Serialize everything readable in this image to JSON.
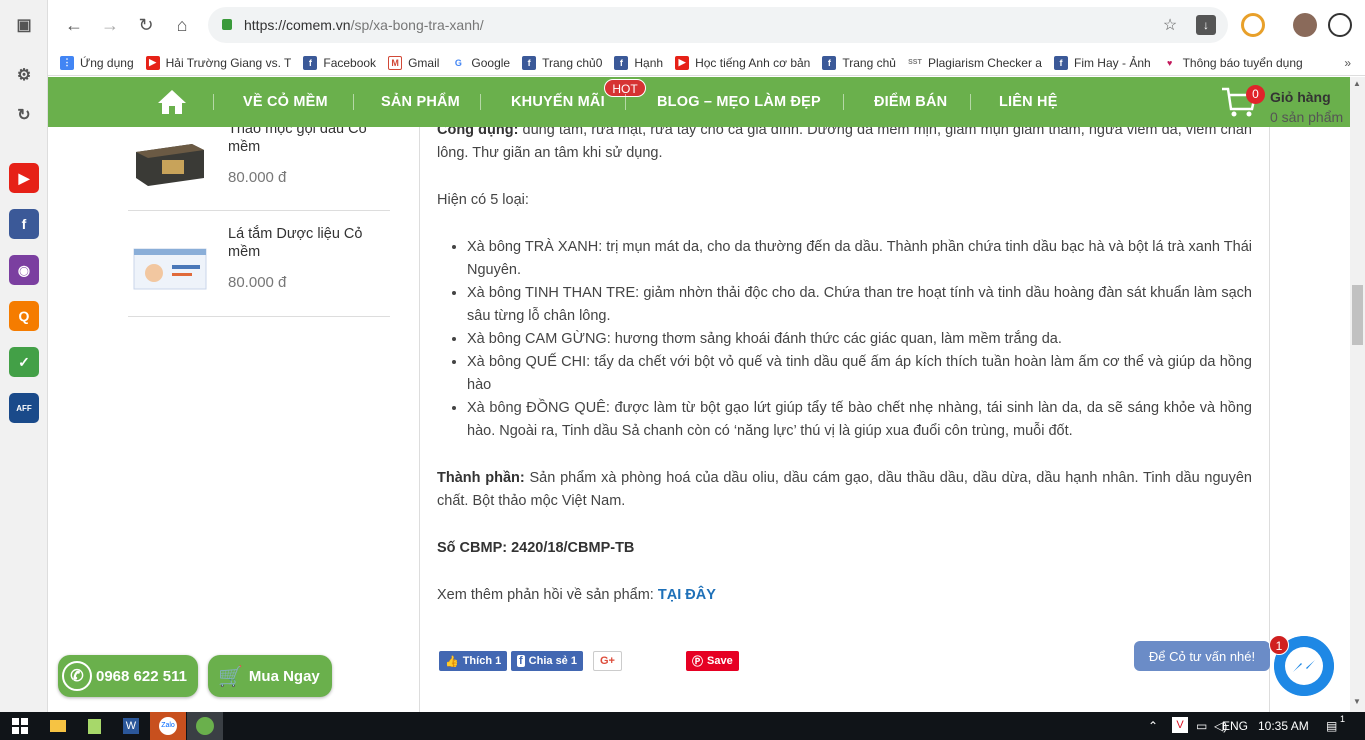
{
  "browser": {
    "url_host": "https://comem.vn",
    "url_path": "/sp/xa-bong-tra-xanh/",
    "bookmarks": [
      {
        "label": "Ứng dụng",
        "icon": "apps-grid-icon",
        "color": "#4285f4"
      },
      {
        "label": "Hải Trường Giang vs. T",
        "icon": "youtube-icon",
        "color": "#e62117"
      },
      {
        "label": "Facebook",
        "icon": "facebook-icon",
        "color": "#3b5998"
      },
      {
        "label": "Gmail",
        "icon": "gmail-icon",
        "color": "#d14836"
      },
      {
        "label": "Google",
        "icon": "google-icon",
        "color": "#4285f4"
      },
      {
        "label": "Trang chủ0",
        "icon": "facebook-icon",
        "color": "#3b5998"
      },
      {
        "label": "Hạnh",
        "icon": "facebook-icon",
        "color": "#3b5998"
      },
      {
        "label": "Học tiếng Anh cơ bản",
        "icon": "youtube-icon",
        "color": "#e62117"
      },
      {
        "label": "Trang chủ",
        "icon": "facebook-icon",
        "color": "#3b5998"
      },
      {
        "label": "Plagiarism Checker a",
        "icon": "sst-icon",
        "color": "#777777"
      },
      {
        "label": "Fim Hay - Ảnh",
        "icon": "facebook-icon",
        "color": "#3b5998"
      },
      {
        "label": "Thông báo tuyển dụng",
        "icon": "heart-icon",
        "color": "#c2185b"
      }
    ]
  },
  "nav": {
    "items": [
      "VỀ CỎ MỀM",
      "SẢN PHẨM",
      "KHUYẾN MÃI",
      "BLOG – MẸO LÀM ĐẸP",
      "ĐIỂM BÁN",
      "LIÊN HỆ"
    ],
    "hot_badge": "HOT",
    "cart_badge": "0",
    "cart_title": "Giỏ hàng",
    "cart_count": "0 sản phẩm"
  },
  "sidebar_products": [
    {
      "name": "Thảo mộc gội đầu Cỏ mềm",
      "price": "80.000 đ"
    },
    {
      "name": "Lá tắm Dược liệu Cỏ mềm",
      "price": "80.000 đ"
    }
  ],
  "article": {
    "uses_label": "Công dụng:",
    "uses_text": "dùng tắm, rửa mặt, rửa tay cho cả gia đình. Dưỡng da mềm mịn, giảm mụn giảm thâm, ngừa viêm da, viêm chân lông. Thư giãn an tâm khi sử dụng.",
    "types_intro": "Hiện có 5 loại:",
    "types": [
      "Xà bông TRÀ XANH: trị mụn mát da, cho da thường đến da dầu. Thành phần chứa tinh dầu bạc hà và bột lá trà xanh Thái Nguyên.",
      "Xà bông TINH THAN TRE: giảm nhờn thải độc cho da. Chứa than tre hoạt tính và tinh dầu hoàng đàn sát khuẩn làm sạch sâu từng lỗ chân lông.",
      "Xà bông CAM GỪNG: hương thơm sảng khoái đánh thức các giác quan, làm mềm trắng da.",
      "Xà bông QUẾ CHI: tẩy da chết với bột vỏ quế và tinh dầu quế ấm áp kích thích tuần hoàn làm ấm cơ thể và giúp da hồng hào",
      "Xà bông ĐỒNG QUÊ: được làm từ bột gạo lứt giúp tẩy tế bào chết nhẹ nhàng, tái sinh làn da, da sẽ sáng khỏe và hồng hào. Ngoài ra, Tinh dầu Sả chanh còn có ‘năng lực’ thú vị là giúp xua đuổi côn trùng, muỗi đốt."
    ],
    "ingredients_label": "Thành phần:",
    "ingredients_text": "Sản phẩm xà phòng hoá của dầu oliu, dầu cám gạo, dầu thầu dầu, dầu dừa, dầu hạnh nhân. Tinh dầu nguyên chất. Bột thảo mộc Việt Nam.",
    "license": "Số CBMP: 2420/18/CBMP-TB",
    "feedback_text": "Xem thêm phản hồi về sản phẩm:",
    "feedback_link": "TẠI ĐÂY"
  },
  "social": {
    "like": "Thích 1",
    "share": "Chia sẻ 1",
    "gplus": "G+",
    "save": "Save"
  },
  "floating": {
    "phone": "0968 622 511",
    "buy": "Mua Ngay",
    "chat_tip": "Để Cỏ tư vấn nhé!",
    "msg_badge": "1"
  },
  "taskbar": {
    "lang": "ENG",
    "time": "10:35 AM",
    "tray_badge": "1"
  },
  "colors": {
    "brand_green": "#6ab04c",
    "link_blue": "#1e70b8",
    "hot_red": "#d63333"
  }
}
